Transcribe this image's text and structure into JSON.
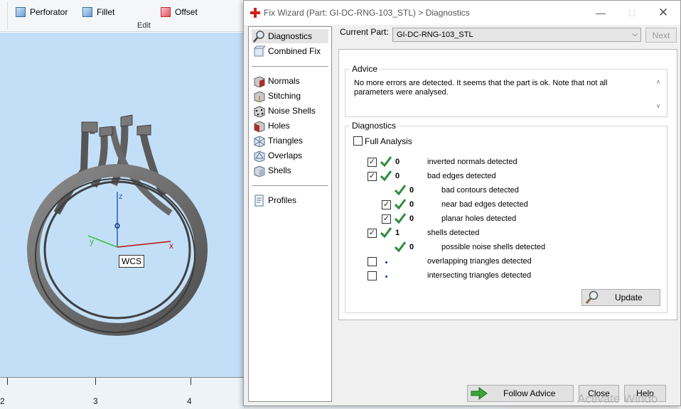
{
  "ribbon": {
    "items": [
      {
        "label": "Perforator",
        "icon": "perforator-icon"
      },
      {
        "label": "Fillet",
        "icon": "fillet-icon"
      },
      {
        "label": "Offset",
        "icon": "offset-icon"
      }
    ],
    "group_label": "Edit"
  },
  "viewport": {
    "axis_labels": {
      "z": "z",
      "y": "y",
      "x": "x"
    },
    "wcs_label": "WCS",
    "ruler_labels": [
      "2",
      "3",
      "4"
    ],
    "background_color": "#c3dff8"
  },
  "dialog": {
    "title": "Fix Wizard (Part: GI-DC-RNG-103_STL) > Diagnostics",
    "nav": {
      "items": [
        {
          "label": "Diagnostics",
          "icon": "magnifier-icon",
          "active": true
        },
        {
          "label": "Combined Fix",
          "icon": "combined-fix-icon"
        },
        {
          "label": "Normals",
          "icon": "normals-cube-icon"
        },
        {
          "label": "Stitching",
          "icon": "stitching-cube-icon"
        },
        {
          "label": "Noise Shells",
          "icon": "noise-shells-icon"
        },
        {
          "label": "Holes",
          "icon": "holes-cube-icon"
        },
        {
          "label": "Triangles",
          "icon": "triangles-icon"
        },
        {
          "label": "Overlaps",
          "icon": "overlaps-icon"
        },
        {
          "label": "Shells",
          "icon": "shells-icon"
        },
        {
          "label": "Profiles",
          "icon": "profiles-icon"
        }
      ]
    },
    "current_part_label": "Current Part:",
    "current_part_value": "GI-DC-RNG-103_STL",
    "next_label": "Next",
    "advice": {
      "title": "Advice",
      "text": "No more errors are detected. It seems that the part is ok. Note that not all parameters were analysed."
    },
    "diagnostics": {
      "title": "Diagnostics",
      "full_analysis_label": "Full Analysis",
      "full_analysis_checked": false,
      "rows": [
        {
          "checkbox": true,
          "checked": true,
          "status": "ok",
          "count": "0",
          "label": "inverted normals detected"
        },
        {
          "checkbox": true,
          "checked": true,
          "status": "ok",
          "count": "0",
          "label": "bad edges detected"
        },
        {
          "checkbox": false,
          "status": "ok",
          "count": "0",
          "label": "bad contours detected"
        },
        {
          "checkbox": true,
          "checked": true,
          "status": "ok",
          "count": "0",
          "label": "near bad edges detected"
        },
        {
          "checkbox": true,
          "checked": true,
          "status": "ok",
          "count": "0",
          "label": "planar holes detected"
        },
        {
          "checkbox": true,
          "checked": true,
          "status": "ok",
          "count": "1",
          "label": "shells detected"
        },
        {
          "checkbox": false,
          "status": "ok",
          "count": "0",
          "label": "possible noise shells detected"
        },
        {
          "checkbox": true,
          "checked": false,
          "status": "pending",
          "count": "",
          "label": "overlapping triangles detected"
        },
        {
          "checkbox": true,
          "checked": false,
          "status": "pending",
          "count": "",
          "label": "intersecting triangles detected"
        }
      ]
    },
    "update_label": "Update",
    "buttons": {
      "follow_advice": "Follow Advice",
      "close": "Close",
      "help": "Help"
    },
    "colors": {
      "check_green": "#2e8b3a",
      "follow_arrow_green": "#3aa53a"
    }
  },
  "watermark": "Activate Windo"
}
